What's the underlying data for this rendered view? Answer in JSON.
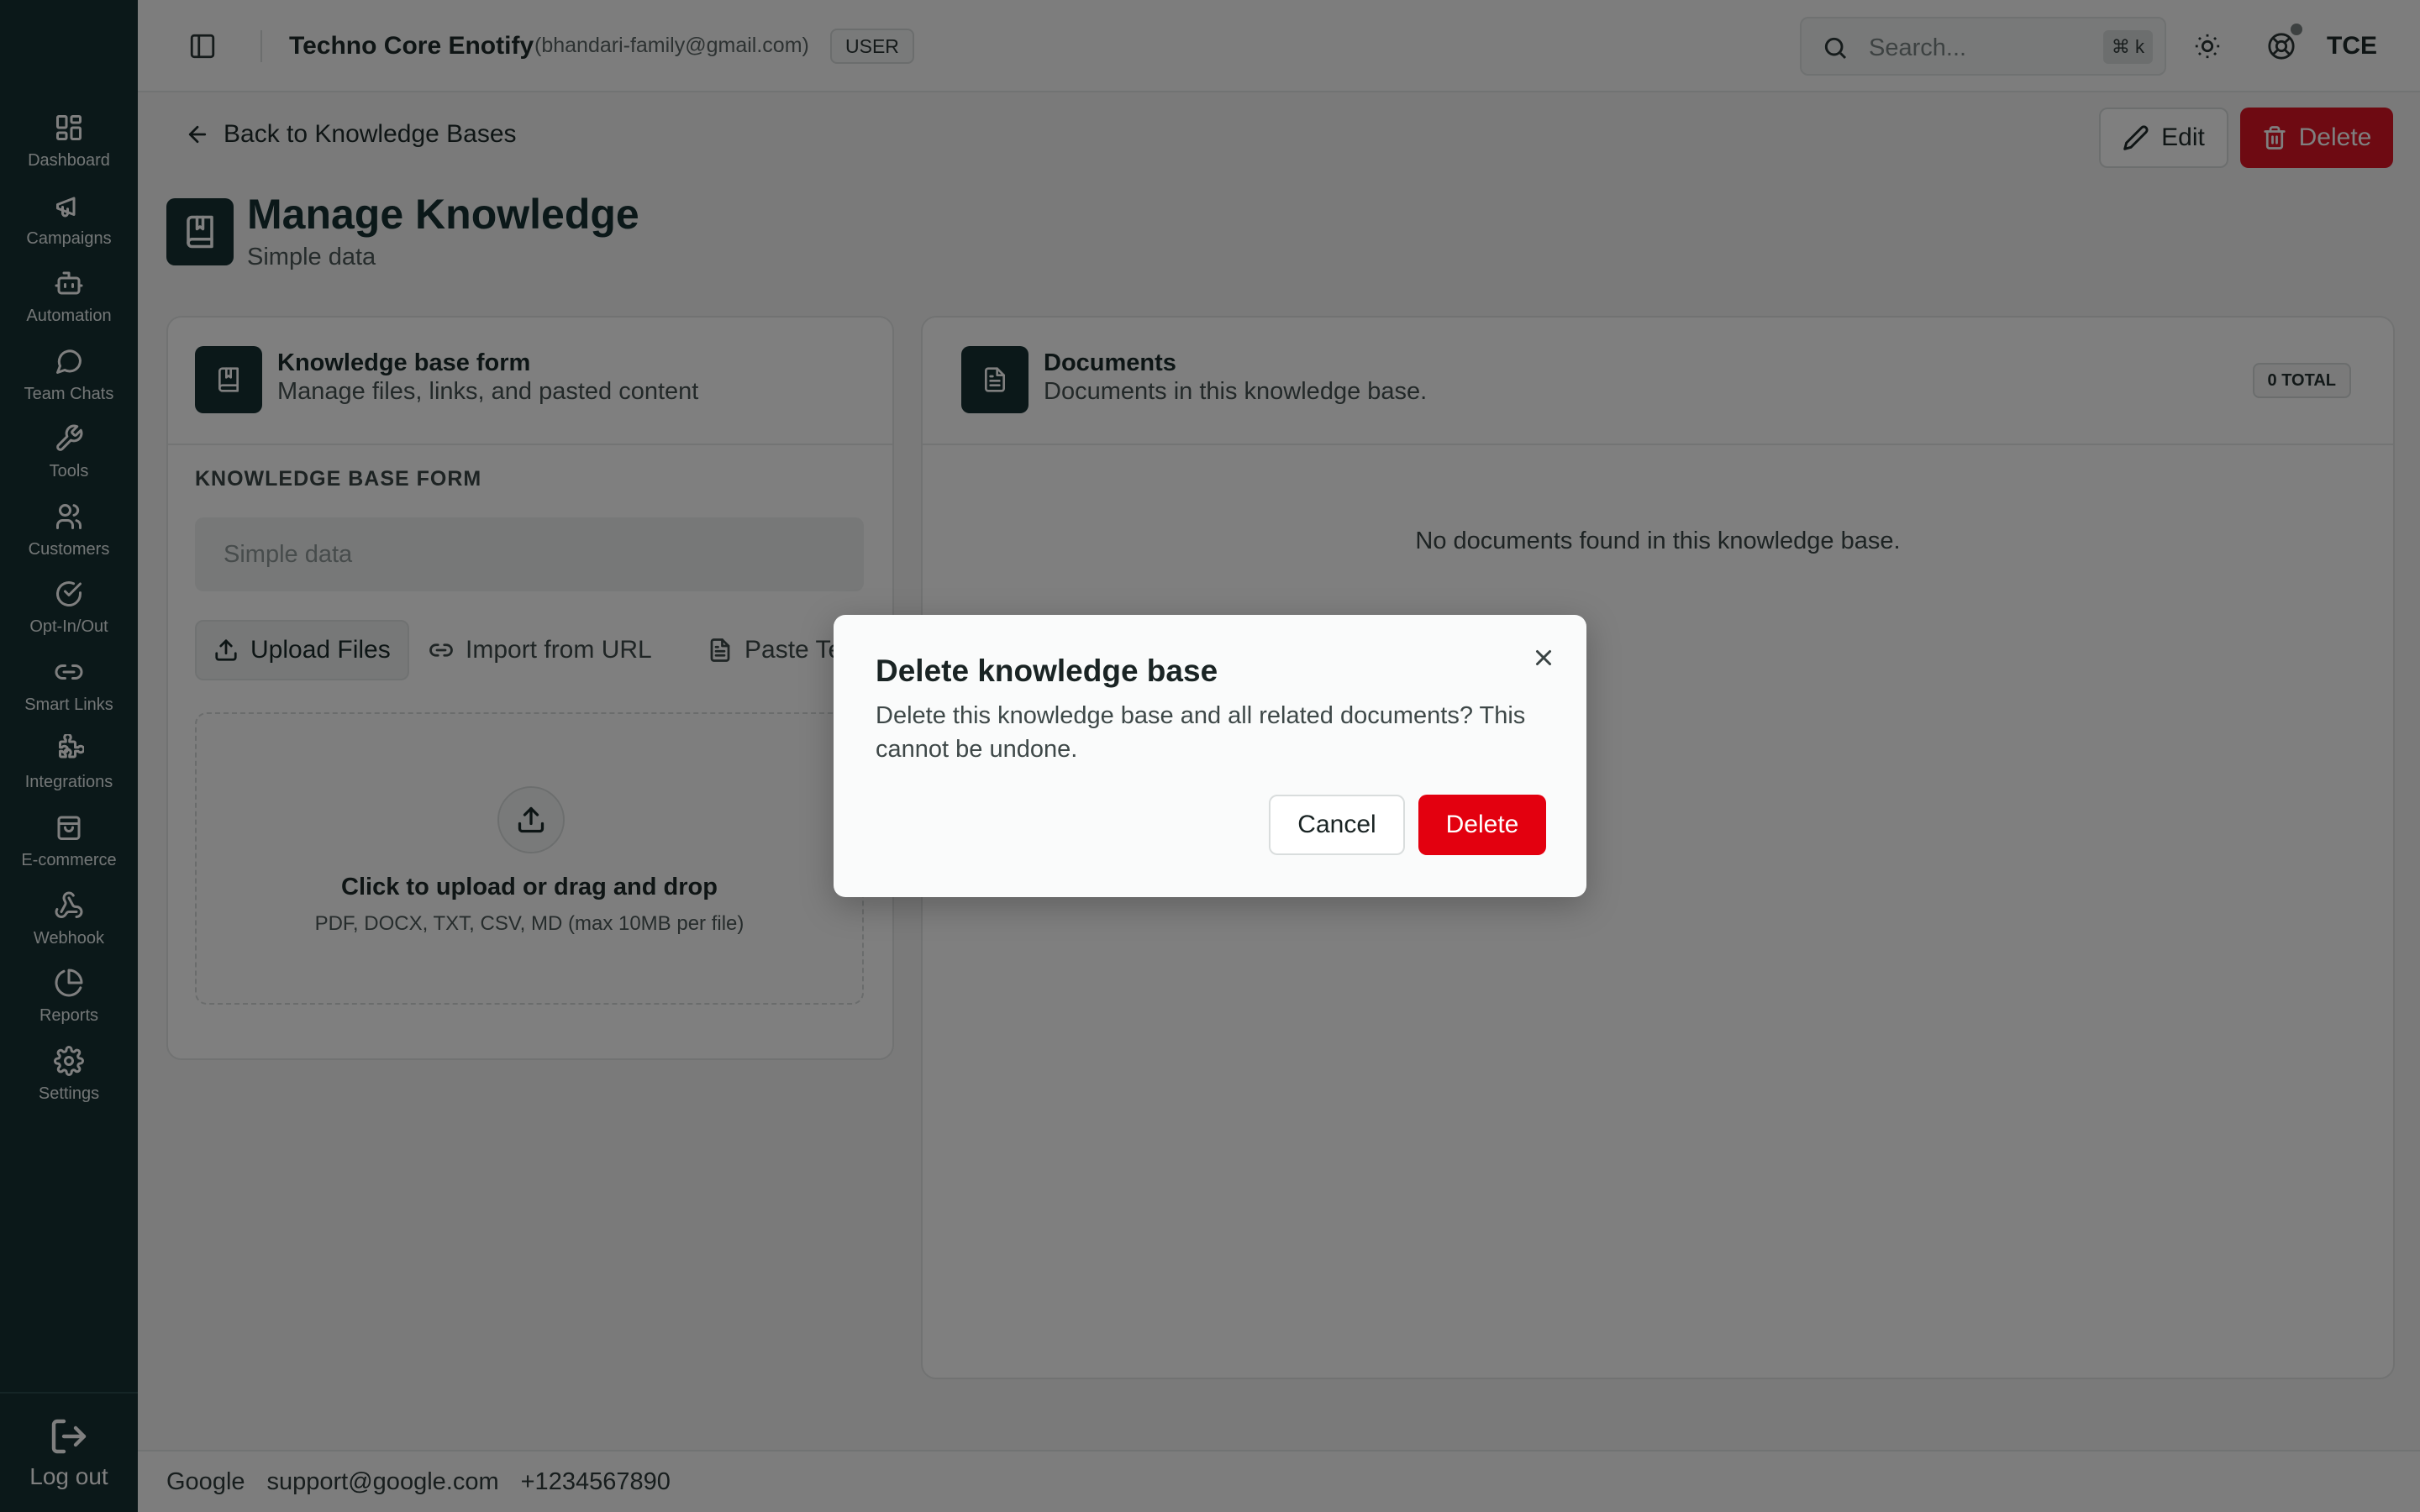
{
  "sidebar": {
    "items": [
      {
        "label": "Dashboard",
        "icon": "layout-grid-icon"
      },
      {
        "label": "Campaigns",
        "icon": "megaphone-icon"
      },
      {
        "label": "Automation",
        "icon": "bot-icon"
      },
      {
        "label": "Team Chats",
        "icon": "message-circle-icon"
      },
      {
        "label": "Tools",
        "icon": "wrench-icon"
      },
      {
        "label": "Customers",
        "icon": "users-icon"
      },
      {
        "label": "Opt-In/Out",
        "icon": "circle-check-icon"
      },
      {
        "label": "Smart Links",
        "icon": "link-icon"
      },
      {
        "label": "Integrations",
        "icon": "puzzle-icon"
      },
      {
        "label": "E-commerce",
        "icon": "shopping-bag-icon"
      },
      {
        "label": "Webhook",
        "icon": "webhook-icon"
      },
      {
        "label": "Reports",
        "icon": "pie-chart-icon"
      },
      {
        "label": "Settings",
        "icon": "gear-icon"
      }
    ],
    "logout_label": "Log out"
  },
  "header": {
    "org_name": "Techno Core Enotify",
    "email": "(bhandari-family@gmail.com)",
    "role": "USER",
    "search_placeholder": "Search...",
    "search_shortcut": "⌘ k",
    "avatar_initials": "TCE"
  },
  "page": {
    "back_label": "Back to Knowledge Bases",
    "edit_label": "Edit",
    "delete_label": "Delete",
    "title": "Manage Knowledge",
    "subtitle": "Simple data"
  },
  "form_card": {
    "title": "Knowledge base form",
    "subtitle": "Manage files, links, and pasted content",
    "section_label": "KNOWLEDGE BASE FORM",
    "name_placeholder": "Simple data",
    "tabs": {
      "upload": "Upload Files",
      "url": "Import from URL",
      "paste": "Paste Text"
    },
    "dropzone_main": "Click to upload or drag and drop",
    "dropzone_hint": "PDF, DOCX, TXT, CSV, MD (max 10MB per file)"
  },
  "documents_card": {
    "title": "Documents",
    "subtitle": "Documents in this knowledge base.",
    "total_badge": "0 TOTAL",
    "empty_message": "No documents found in this knowledge base."
  },
  "footer": {
    "company": "Google",
    "email": "support@google.com",
    "phone": "+1234567890"
  },
  "modal": {
    "title": "Delete knowledge base",
    "body": "Delete this knowledge base and all related documents? This cannot be undone.",
    "cancel_label": "Cancel",
    "confirm_label": "Delete"
  },
  "colors": {
    "sidebar_bg": "#163033",
    "danger": "#e3000f",
    "overlay": "rgba(0,0,0,0.5)"
  }
}
